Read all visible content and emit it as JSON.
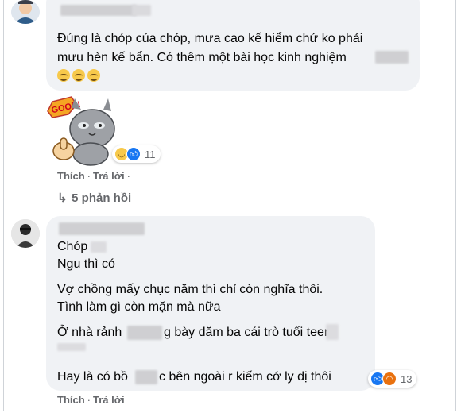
{
  "comment1": {
    "text_line1": "Đúng là chóp của chóp, mưa cao kế hiểm chứ ko phải",
    "text_line2": "mưu hèn kế bẩn. Có thêm một bài học kinh nghiệm",
    "emojis": [
      "grinning-sweat-emoji",
      "grinning-sweat-emoji",
      "grinning-sweat-emoji"
    ],
    "sticker_caption": "GOOD!",
    "reaction_count": "11",
    "like_label": "Thích",
    "reply_label": "Trả lời",
    "replies_label": "5 phản hồi"
  },
  "comment2": {
    "line_chop": "Chóp",
    "line_ngu": "Ngu thì có",
    "line_vo": "Vợ chồng mấy chục năm thì chỉ còn nghĩa thôi.",
    "line_tinh": "Tình làm gì còn mặn mà nữa",
    "line_o_part1": "Ở nhà rảnh",
    "line_o_part2": "g bày dăm ba cái trò tuổi teen",
    "line_hay_part1": "Hay là có bồ",
    "line_hay_part2": "c bên ngoài r kiếm cớ ly dị thôi",
    "reaction_count": "13",
    "like_label": "Thích",
    "reply_label": "Trả lời"
  },
  "colors": {
    "bubble": "#f0f2f5",
    "like_blue": "#1877f2",
    "angry_orange": "#e9710f",
    "meta_gray": "#65676b"
  }
}
